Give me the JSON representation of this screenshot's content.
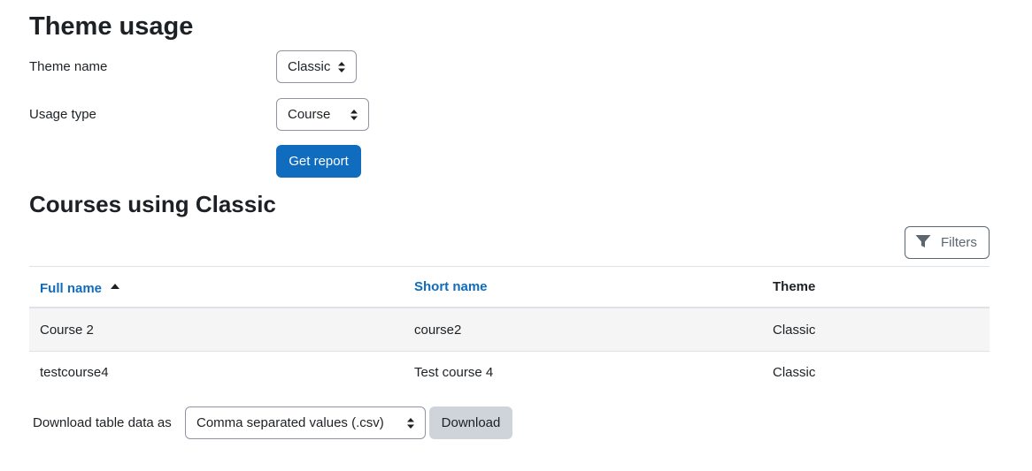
{
  "page": {
    "title": "Theme usage"
  },
  "form": {
    "theme_name_label": "Theme name",
    "theme_name_value": "Classic",
    "usage_type_label": "Usage type",
    "usage_type_value": "Course",
    "submit_label": "Get report"
  },
  "report": {
    "title": "Courses using Classic",
    "filters_label": "Filters",
    "columns": [
      "Full name",
      "Short name",
      "Theme"
    ],
    "sort_column": "Full name",
    "sort_direction": "ascending",
    "rows": [
      {
        "full_name": "Course 2",
        "short_name": "course2",
        "theme": "Classic"
      },
      {
        "full_name": "testcourse4",
        "short_name": "Test course 4",
        "theme": "Classic"
      }
    ]
  },
  "download": {
    "label": "Download table data as",
    "format_value": "Comma separated values (.csv)",
    "button_label": "Download"
  },
  "colors": {
    "primary": "#0f6cbf",
    "text": "#1d2125",
    "secondary_button": "#ced4da",
    "stripe": "#f5f5f5"
  },
  "icons": {
    "sort": "sort-ascending-icon",
    "filter": "filter-icon",
    "select": "select-arrows-icon"
  }
}
